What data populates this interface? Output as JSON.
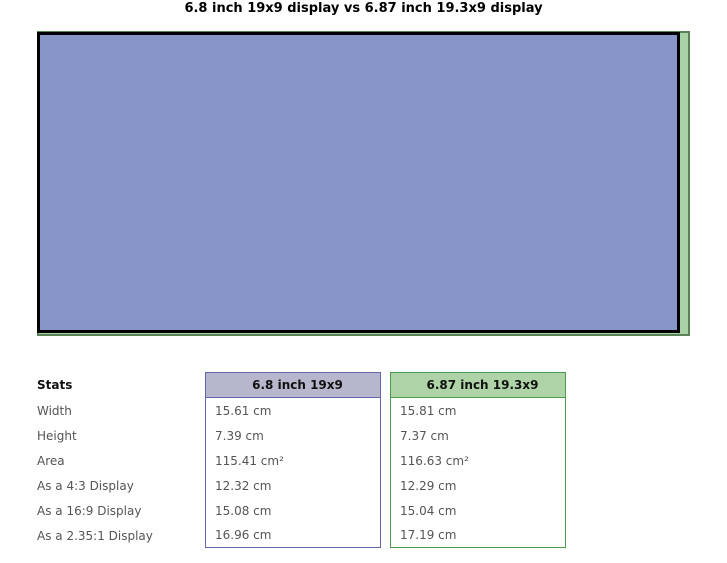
{
  "title": "6.8 inch 19x9 display vs 6.87 inch 19.3x9 display",
  "colors": {
    "display_a_fill": "#8795c8",
    "display_a_border": "#000000",
    "display_b_fill": "#a9d3a6",
    "display_b_border": "#5b8159",
    "header_a_bg": "#b6b6cc",
    "header_a_border": "#6666aa",
    "header_b_bg": "#aed3a7",
    "header_b_border": "#4f9a4f",
    "text": "#555555",
    "background": "#ffffff"
  },
  "table": {
    "headers": [
      "Stats",
      "6.8 inch 19x9",
      "6.87 inch 19.3x9"
    ],
    "rows": [
      {
        "label": "Width",
        "a": "15.61 cm",
        "b": "15.81 cm"
      },
      {
        "label": "Height",
        "a": "7.39 cm",
        "b": "7.37 cm"
      },
      {
        "label": "Area",
        "a": "115.41 cm²",
        "b": "116.63 cm²"
      },
      {
        "label": "As a 4:3 Display",
        "a": "12.32 cm",
        "b": "12.29 cm"
      },
      {
        "label": "As a 16:9 Display",
        "a": "15.08 cm",
        "b": "15.04 cm"
      },
      {
        "label": "As a 2.35:1 Display",
        "a": "16.96 cm",
        "b": "17.19 cm"
      }
    ]
  },
  "chart_data": {
    "type": "bar",
    "title": "6.8 inch 19x9 display vs 6.87 inch 19.3x9 display",
    "xlabel": "",
    "ylabel": "",
    "categories": [
      "6.8 inch 19x9",
      "6.87 inch 19.3x9"
    ],
    "series": [
      {
        "name": "Width (cm)",
        "values": [
          15.61,
          15.81
        ]
      },
      {
        "name": "Height (cm)",
        "values": [
          7.39,
          7.37
        ]
      },
      {
        "name": "Area (cm²)",
        "values": [
          115.41,
          116.63
        ]
      },
      {
        "name": "As a 4:3 Display (cm)",
        "values": [
          12.32,
          12.29
        ]
      },
      {
        "name": "As a 16:9 Display (cm)",
        "values": [
          15.08,
          15.04
        ]
      },
      {
        "name": "As a 2.35:1 Display (cm)",
        "values": [
          16.96,
          17.19
        ]
      }
    ],
    "legend_position": "none",
    "grid": false
  }
}
